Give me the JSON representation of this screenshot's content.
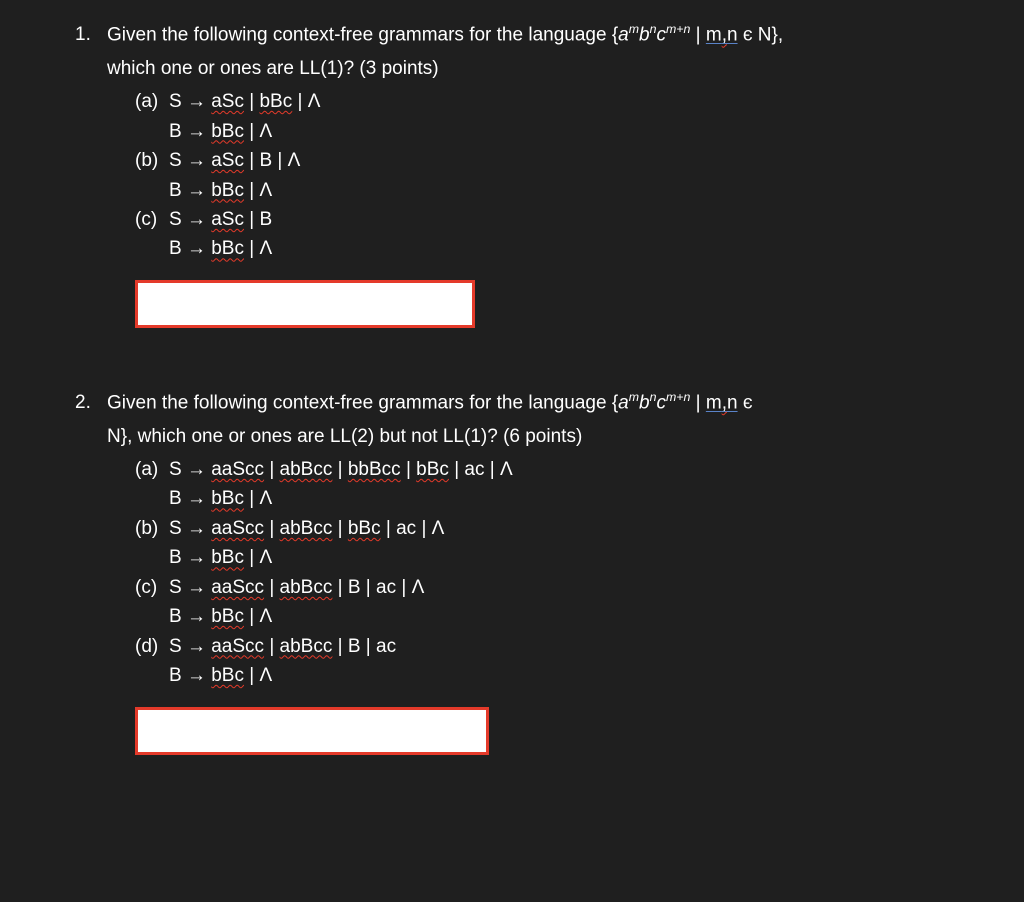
{
  "q1": {
    "number": "1.",
    "prompt_pre": "Given the following context-free grammars for the language {",
    "lang_a": "a",
    "lang_m": "m",
    "lang_b": "b",
    "lang_n": "n",
    "lang_c": "c",
    "lang_mn": "m+n",
    "lang_bar": "  | ",
    "lang_mn_nat_1": "m",
    "lang_mn_nat_2": ",",
    "lang_mn_nat_3": "n",
    "lang_in": " є N},",
    "prompt_line2": "which one or ones are LL(1)?    (3 points)",
    "a_label": "(a)",
    "a_s_pre": "S → ",
    "a_s_sp1": "aSc",
    "a_s_mid1": " | ",
    "a_s_sp2": "bBc",
    "a_s_tail": " | Λ",
    "a_b_pre": "B → ",
    "a_b_sp1": "bBc",
    "a_b_tail": " | Λ",
    "b_label": "(b)",
    "b_s_pre": "S → ",
    "b_s_sp1": "aSc",
    "b_s_tail": " | B | Λ",
    "b_b_pre": "B → ",
    "b_b_sp1": "bBc",
    "b_b_tail": " | Λ",
    "c_label": "(c)",
    "c_s_pre": " S → ",
    "c_s_sp1": "aSc",
    "c_s_tail": " | B",
    "c_b_pre": "B → ",
    "c_b_sp1": "bBc",
    "c_b_tail": " | Λ"
  },
  "q2": {
    "number": "2.",
    "prompt_pre": "Given the following context-free grammars for the language {",
    "lang_a": "a",
    "lang_m": "m",
    "lang_b": "b",
    "lang_n": "n",
    "lang_c": "c",
    "lang_mn": "m+n",
    "lang_bar": "  | ",
    "lang_mn_nat_1": "m",
    "lang_mn_nat_2": ",",
    "lang_mn_nat_3": "n",
    "lang_in": " є",
    "prompt_line2": "N}, which one or ones are LL(2) but not LL(1)?    (6 points)",
    "a_label": "(a)",
    "a_s_pre": " S → ",
    "a_s_sp1": "aaScc",
    "a_s_mid1": " | ",
    "a_s_sp2": "abBcc",
    "a_s_mid2": " | ",
    "a_s_sp3": "bbBcc",
    "a_s_mid3": " | ",
    "a_s_sp4": "bBc",
    "a_s_tail": " | ac | Λ",
    "a_b_pre": "B → ",
    "a_b_sp1": "bBc",
    "a_b_tail": " | Λ",
    "b_label": "(b)",
    "b_s_pre": " S → ",
    "b_s_sp1": "aaScc",
    "b_s_mid1": " | ",
    "b_s_sp2": "abBcc",
    "b_s_mid2": " | ",
    "b_s_sp3": "bBc",
    "b_s_tail": " | ac | Λ",
    "b_b_pre": "B → ",
    "b_b_sp1": "bBc",
    "b_b_tail": " | Λ",
    "c_label": "(c)",
    "c_s_pre": " S → ",
    "c_s_sp1": "aaScc",
    "c_s_mid1": " | ",
    "c_s_sp2": "abBcc",
    "c_s_tail": " | B | ac | Λ",
    "c_b_pre": "B → ",
    "c_b_sp1": "bBc",
    "c_b_tail": " | Λ",
    "d_label": "(d)",
    "d_s_pre": " S → ",
    "d_s_sp1": "aaScc",
    "d_s_mid1": " | ",
    "d_s_sp2": "abBcc",
    "d_s_tail": " | B | ac",
    "d_b_pre": "B → ",
    "d_b_sp1": "bBc",
    "d_b_tail": " | Λ"
  }
}
